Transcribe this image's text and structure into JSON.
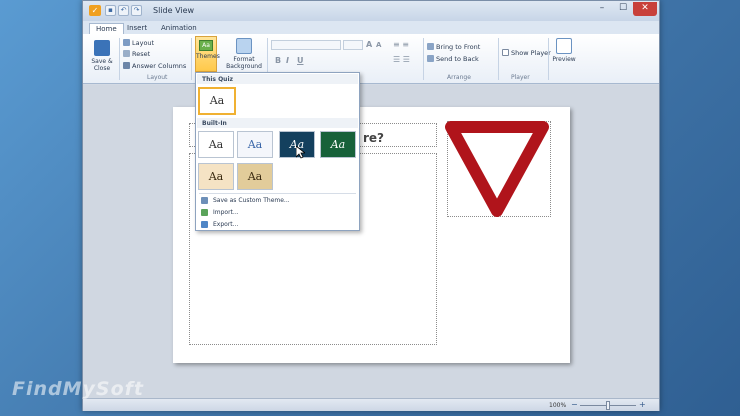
{
  "window": {
    "title": "Slide View",
    "app_icon_glyph": "✓"
  },
  "window_controls": {
    "minimize": "–",
    "maximize": "☐",
    "close": "✕"
  },
  "tabs": [
    {
      "label": "Home"
    },
    {
      "label": "Insert"
    },
    {
      "label": "Animation"
    }
  ],
  "ribbon": {
    "save_close": "Save & Close",
    "layout": "Layout",
    "reset": "Reset",
    "answer_columns": "Answer Columns",
    "group_layout": "Layout",
    "themes": "Themes",
    "themes_icon_text": "Aa",
    "format_background": "Format Background",
    "bring_to_front": "Bring to Front",
    "send_to_back": "Send to Back",
    "group_arrange": "Arrange",
    "show_player": "Show Player",
    "group_player": "Player",
    "preview": "Preview"
  },
  "font_tools": {
    "bold": "B",
    "italic": "I",
    "underline": "U",
    "grow": "A",
    "shrink": "A"
  },
  "dropdown": {
    "this_quiz_header": "This Quiz",
    "builtin_header": "Built-In",
    "theme_label": "Aa",
    "save_custom_theme": "Save as Custom Theme...",
    "import": "Import...",
    "export": "Export...",
    "this_quiz_themes": [
      {
        "bg": "#ffffff",
        "fg": "#333333",
        "selected": true
      }
    ],
    "builtin_themes": [
      {
        "bg": "#ffffff",
        "fg": "#333333"
      },
      {
        "bg": "#f4f6fb",
        "fg": "#3a66a8"
      },
      {
        "bg": "#14405e",
        "fg": "#ffffff"
      },
      {
        "bg": "#17613a",
        "fg": "#ffffff"
      },
      {
        "bg": "#f5e3c4",
        "fg": "#3a2a10"
      },
      {
        "bg": "#e2cc9a",
        "fg": "#3a2a10"
      }
    ]
  },
  "slide": {
    "question_visible_text": "re?"
  },
  "status": {
    "zoom_label": "100%"
  },
  "watermark": "FindMySoft",
  "colors": {
    "accent": "#ffc94a",
    "sign_red": "#b0141b"
  }
}
